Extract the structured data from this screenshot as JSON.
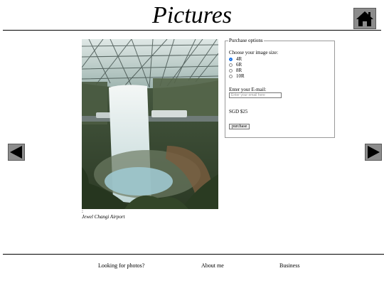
{
  "header": {
    "title": "Pictures"
  },
  "icons": {
    "home": "home-icon",
    "prev": "arrow-left-icon",
    "next": "arrow-right-icon"
  },
  "gallery": {
    "caption_prefix": ":",
    "caption": "Jewel Changi Airport"
  },
  "purchase": {
    "legend": "Purchase options",
    "size_label": "Choose your image size:",
    "sizes": [
      {
        "label": "4R",
        "checked": true
      },
      {
        "label": "6R",
        "checked": false
      },
      {
        "label": "8R",
        "checked": false
      },
      {
        "label": "10R",
        "checked": false
      }
    ],
    "email_label": "Enter your E-mail:",
    "email_placeholder": "Enter your email here",
    "email_value": "",
    "price": "SGD $25",
    "button_label": "purchase"
  },
  "footer": {
    "links": [
      {
        "label": "Looking for photos?"
      },
      {
        "label": "About me"
      },
      {
        "label": "Business"
      }
    ]
  },
  "colors": {
    "button_gray": "#8c8c8c",
    "radio_selected": "#1a73e8"
  }
}
